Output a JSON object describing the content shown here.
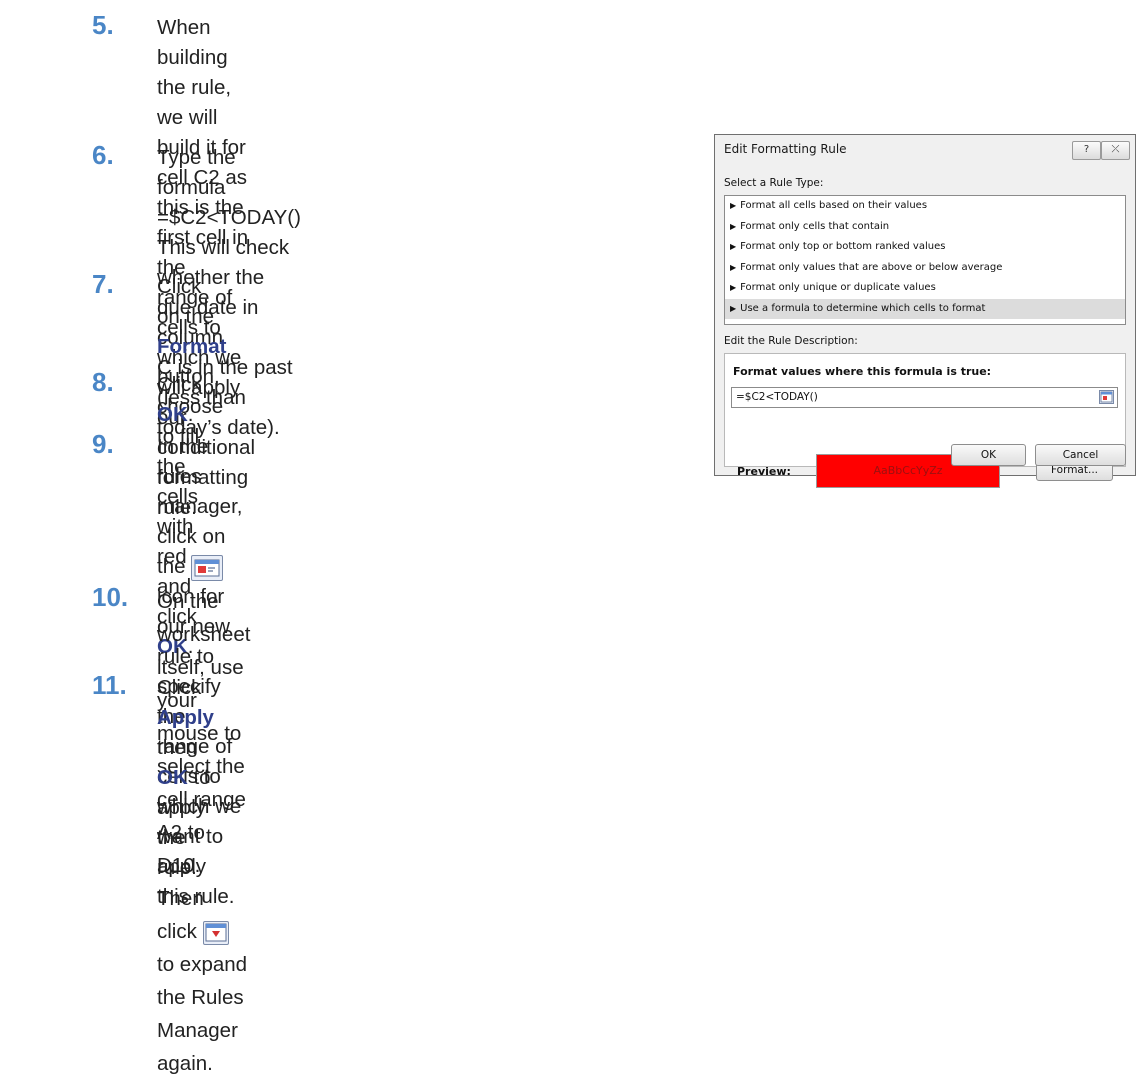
{
  "steps": [
    {
      "num": "5.",
      "lines": [
        "When building the rule, we will build it for cell C2 as this is the first cell in the",
        "range of cells to which we will apply our conditional formatting rule."
      ]
    },
    {
      "num": "6.",
      "lines": [
        "Type the formula =$C2<TODAY()",
        "This will check whether the due date in column",
        "C is in the past (less than today’s date)."
      ]
    },
    {
      "num": "7.",
      "pre1": "Click on the ",
      "kw1": "Format",
      "post1": " button, choose to fill the",
      "pre2": "cells with red and click ",
      "kw2": "OK",
      "post2": "."
    },
    {
      "num": "8.",
      "pre": "Click ",
      "kw": "OK",
      "post": "."
    },
    {
      "num": "9.",
      "pre": "In the rules manager, click on the ",
      "post": " icon for",
      "line2": "our new rule to specify the range of cells to",
      "line3": "which we want to apply this rule."
    },
    {
      "num": "10.",
      "line1": "On the worksheet itself, use your mouse to select the cell range A2 to D10. Then",
      "pre2": "click ",
      "post2": " to expand the Rules Manager again."
    },
    {
      "num": "11.",
      "pre": "Click ",
      "kw1": "Apply",
      "mid": " then ",
      "kw2": "OK",
      "post": " to apply the rule."
    }
  ],
  "dialog": {
    "title": "Edit Formatting Rule",
    "help_label": "?",
    "close_label": "⤫",
    "select_rule_type_label": "Select a Rule Type:",
    "rule_types": [
      "Format all cells based on their values",
      "Format only cells that contain",
      "Format only top or bottom ranked values",
      "Format only values that are above or below average",
      "Format only unique or duplicate values",
      "Use a formula to determine which cells to format"
    ],
    "selected_rule_index": 5,
    "edit_description_label": "Edit the Rule Description:",
    "formula_heading": "Format values where this formula is true:",
    "formula_value": "=$C2<TODAY()",
    "preview_label": "Preview:",
    "preview_text": "AaBbCcYyZz",
    "format_button": "Format...",
    "ok_button": "OK",
    "cancel_button": "Cancel"
  },
  "icons": {
    "range_select": "collapse-dialog-icon",
    "expand": "expand-dialog-icon"
  },
  "colors": {
    "step_number": "#4a86c6",
    "keyword": "#2f3f8a",
    "preview_fill": "#ff0000"
  }
}
